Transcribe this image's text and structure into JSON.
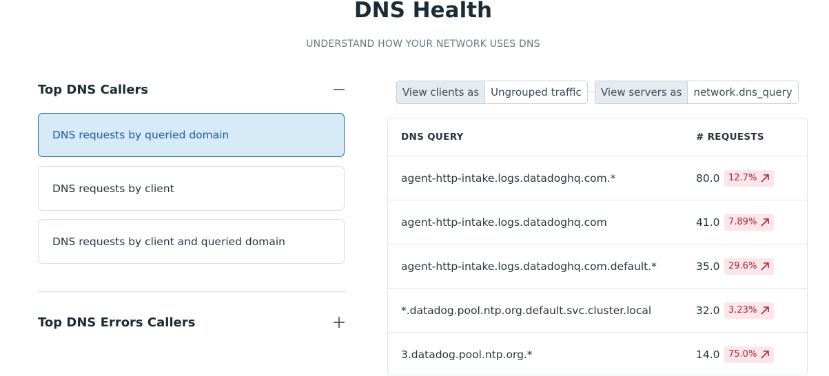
{
  "header": {
    "title": "DNS Health",
    "subtitle": "UNDERSTAND HOW YOUR NETWORK USES DNS"
  },
  "sections": {
    "callers": {
      "title": "Top DNS Callers",
      "toggle_icon": "minus-icon",
      "cards": [
        {
          "label": "DNS requests by queried domain",
          "active": true
        },
        {
          "label": "DNS requests by client",
          "active": false
        },
        {
          "label": "DNS requests by client and queried domain",
          "active": false
        }
      ]
    },
    "errors": {
      "title": "Top DNS Errors Callers",
      "toggle_icon": "plus-icon"
    }
  },
  "filters": {
    "clients": {
      "label": "View clients as",
      "value": "Ungrouped traffic"
    },
    "servers": {
      "label": "View servers as",
      "value": "network.dns_query"
    }
  },
  "table": {
    "headers": {
      "query": "DNS QUERY",
      "requests": "# REQUESTS"
    },
    "rows": [
      {
        "query": "agent-http-intake.logs.datadoghq.com.*",
        "requests": "80.0",
        "change": "12.7%"
      },
      {
        "query": "agent-http-intake.logs.datadoghq.com",
        "requests": "41.0",
        "change": "7.89%"
      },
      {
        "query": "agent-http-intake.logs.datadoghq.com.default.*",
        "requests": "35.0",
        "change": "29.6%"
      },
      {
        "query": "*.datadog.pool.ntp.org.default.svc.cluster.local",
        "requests": "32.0",
        "change": "3.23%"
      },
      {
        "query": "3.datadog.pool.ntp.org.*",
        "requests": "14.0",
        "change": "75.0%"
      }
    ],
    "change_icon": "arrow-up-right-icon"
  },
  "colors": {
    "accent": "#1e5a99",
    "active_card_bg": "#d6eaf8",
    "badge_bg": "#fbe7ea",
    "badge_text": "#b2203a"
  }
}
